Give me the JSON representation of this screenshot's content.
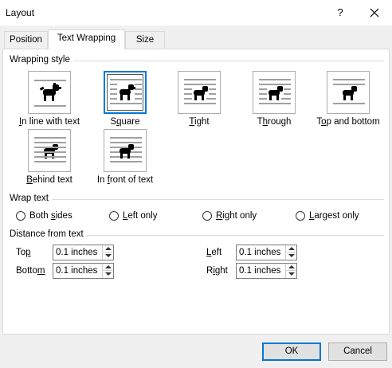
{
  "window": {
    "title": "Layout",
    "help_glyph": "?",
    "close_icon": "close-icon"
  },
  "tabs": [
    {
      "label": "Position",
      "active": false
    },
    {
      "label": "Text Wrapping",
      "active": true
    },
    {
      "label": "Size",
      "active": false
    }
  ],
  "wrapping_style": {
    "heading": "Wrapping style",
    "options": [
      {
        "pre": "",
        "key": "I",
        "post": "n line with text",
        "icon": "wrap-inline-icon",
        "selected": false
      },
      {
        "pre": "S",
        "key": "q",
        "post": "uare",
        "icon": "wrap-square-icon",
        "selected": true
      },
      {
        "pre": "",
        "key": "T",
        "post": "ight",
        "icon": "wrap-tight-icon",
        "selected": false
      },
      {
        "pre": "T",
        "key": "h",
        "post": "rough",
        "icon": "wrap-through-icon",
        "selected": false
      },
      {
        "pre": "T",
        "key": "o",
        "post": "p and bottom",
        "icon": "wrap-top-bottom-icon",
        "selected": false
      },
      {
        "pre": "",
        "key": "B",
        "post": "ehind text",
        "icon": "wrap-behind-icon",
        "selected": false
      },
      {
        "pre": "In ",
        "key": "f",
        "post": "ront of text",
        "icon": "wrap-front-icon",
        "selected": false
      }
    ]
  },
  "wrap_text": {
    "heading": "Wrap text",
    "options": [
      {
        "pre": "Both ",
        "key": "s",
        "post": "ides",
        "checked": false
      },
      {
        "pre": "",
        "key": "L",
        "post": "eft only",
        "checked": false
      },
      {
        "pre": "",
        "key": "R",
        "post": "ight only",
        "checked": false
      },
      {
        "pre": "",
        "key": "L",
        "post": "argest only",
        "checked": false
      }
    ]
  },
  "distance": {
    "heading": "Distance from text",
    "top": {
      "pre": "To",
      "key": "p",
      "post": "",
      "value": "0.1 inches"
    },
    "bottom": {
      "pre": "Botto",
      "key": "m",
      "post": "",
      "value": "0.1 inches"
    },
    "left": {
      "pre": "",
      "key": "L",
      "post": "eft",
      "value": "0.1 inches"
    },
    "right": {
      "pre": "R",
      "key": "i",
      "post": "ght",
      "value": "0.1 inches"
    }
  },
  "buttons": {
    "ok": "OK",
    "cancel": "Cancel"
  }
}
